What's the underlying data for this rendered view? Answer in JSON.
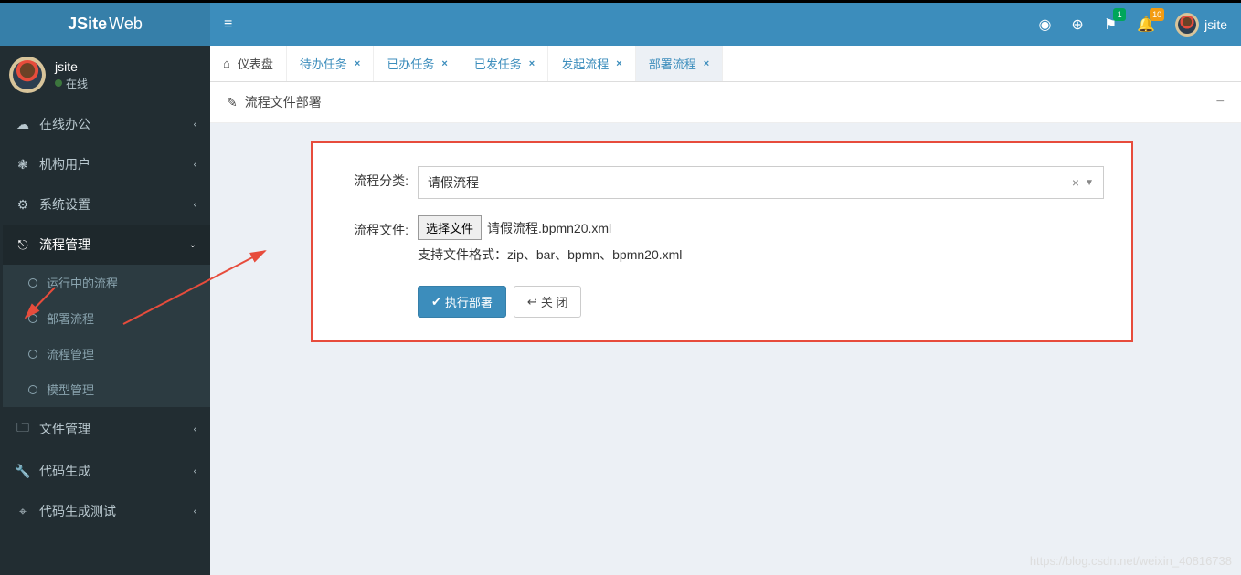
{
  "brand": {
    "bold": "JSite",
    "light": "Web"
  },
  "user": {
    "name": "jsite",
    "status": "在线"
  },
  "topbar": {
    "hamburger": "≡",
    "badge_green": "1",
    "badge_orange": "10",
    "username": "jsite"
  },
  "sidebar": {
    "items": [
      {
        "icon": "☁",
        "label": "在线办公"
      },
      {
        "icon": "❃",
        "label": "机构用户"
      },
      {
        "icon": "⚙",
        "label": "系统设置"
      },
      {
        "icon": "⎋",
        "label": "流程管理",
        "active": true
      },
      {
        "icon": "🗀",
        "label": "文件管理"
      },
      {
        "icon": "🔧",
        "label": "代码生成"
      },
      {
        "icon": "⌖",
        "label": "代码生成测试"
      }
    ],
    "submenu": [
      {
        "label": "运行中的流程"
      },
      {
        "label": "部署流程"
      },
      {
        "label": "流程管理"
      },
      {
        "label": "模型管理"
      }
    ]
  },
  "tabs": [
    {
      "icon": "⌂",
      "label": "仪表盘",
      "closable": false
    },
    {
      "label": "待办任务",
      "closable": true
    },
    {
      "label": "已办任务",
      "closable": true
    },
    {
      "label": "已发任务",
      "closable": true
    },
    {
      "label": "发起流程",
      "closable": true
    },
    {
      "label": "部署流程",
      "closable": true,
      "active": true
    }
  ],
  "page": {
    "title_icon": "✎",
    "title": "流程文件部署"
  },
  "form": {
    "category_label": "流程分类:",
    "category_value": "请假流程",
    "category_clear": "×",
    "file_label": "流程文件:",
    "file_button": "选择文件",
    "file_name": "请假流程.bpmn20.xml",
    "file_hint": "支持文件格式：zip、bar、bpmn、bpmn20.xml",
    "deploy_btn": "执行部署",
    "close_btn": "关 闭"
  },
  "watermark": "https://blog.csdn.net/weixin_40816738"
}
